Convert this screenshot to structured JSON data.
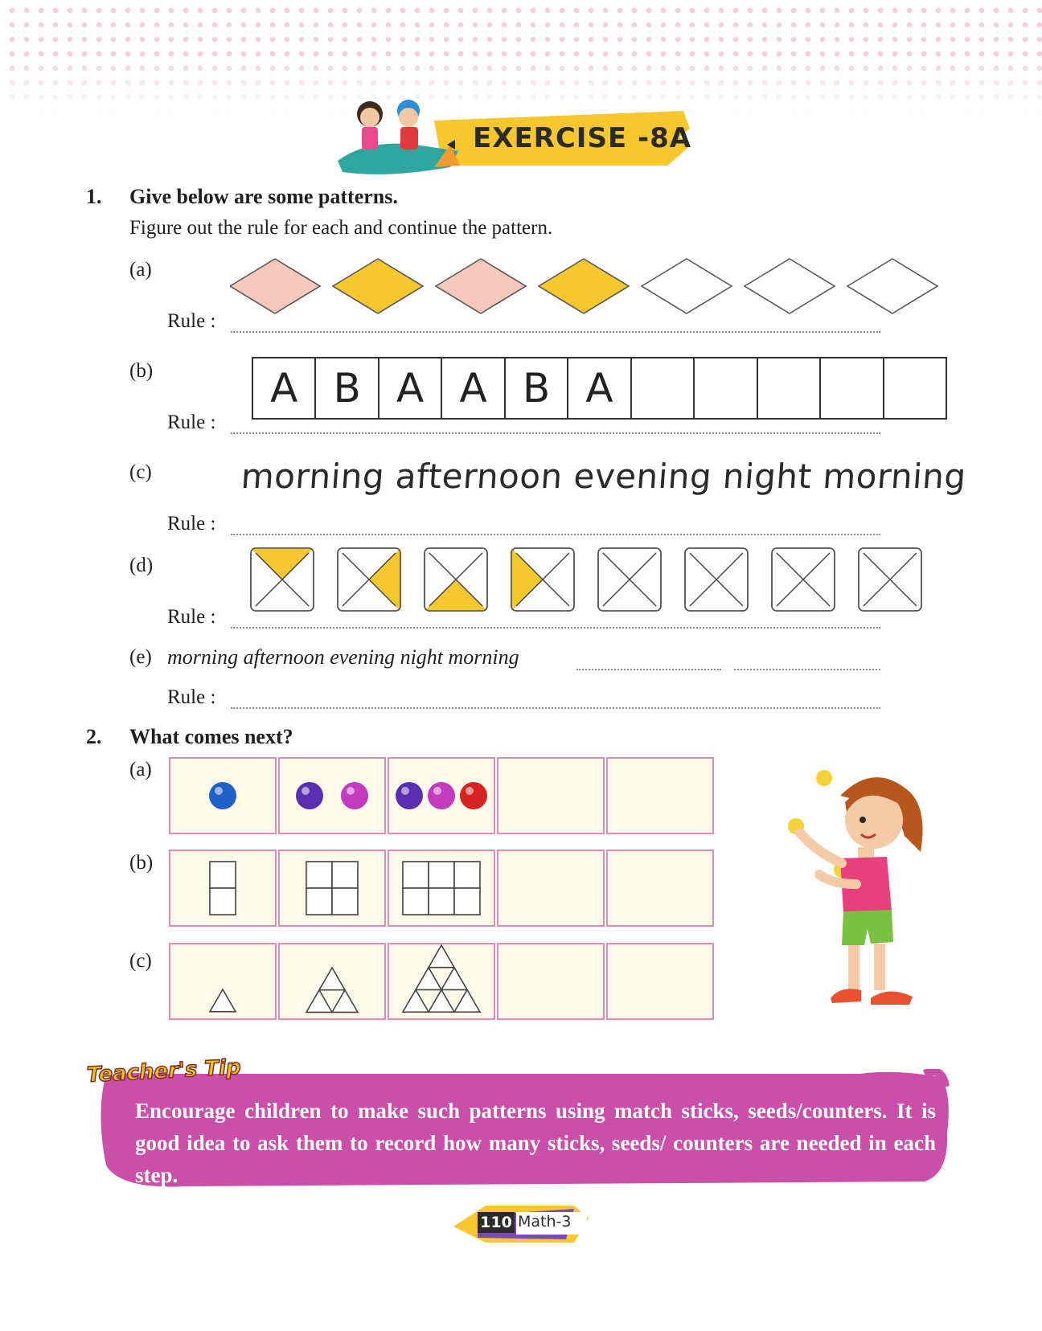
{
  "exercise": {
    "title": "EXERCISE -8A"
  },
  "q1": {
    "number": "1.",
    "heading": "Give below are some patterns.",
    "subheading": "Figure out the rule for each and continue the pattern.",
    "rule_label": "Rule :",
    "a": {
      "label": "(a)",
      "diamond_fills": [
        "#f7c9bd",
        "#f6c72f",
        "#f7c9bd",
        "#f6c72f",
        "#ffffff",
        "#ffffff",
        "#ffffff"
      ]
    },
    "b": {
      "label": "(b)",
      "cells": [
        "A",
        "B",
        "A",
        "A",
        "B",
        "A",
        "",
        "",
        "",
        "",
        ""
      ]
    },
    "c": {
      "label": "(c)",
      "sequence": "morning afternoon evening night morning"
    },
    "d": {
      "label": "(d)",
      "shaded_quadrant": [
        "top",
        "right",
        "bottom",
        "left",
        "none",
        "none",
        "none",
        "none"
      ],
      "shade_color": "#f6c72f"
    },
    "e": {
      "label": "(e)",
      "sequence": "morning afternoon evening night morning"
    }
  },
  "q2": {
    "number": "2.",
    "heading": "What comes next?",
    "a": {
      "label": "(a)",
      "ball_colors": [
        [
          "#1e5fc9"
        ],
        [
          "#5a2fb0",
          "#c23bbd"
        ],
        [
          "#5a2fb0",
          "#c23bbd",
          "#d7231f"
        ],
        [],
        []
      ]
    },
    "b": {
      "label": "(b)",
      "grid_columns": [
        1,
        2,
        3,
        0,
        0
      ]
    },
    "c": {
      "label": "(c)",
      "triangle_rows": [
        1,
        2,
        3,
        0,
        0
      ]
    }
  },
  "tip": {
    "label": "Teacher's Tip",
    "text": "Encourage children to make such patterns using match sticks, seeds/counters. It is good idea to ask them to record how many sticks, seeds/ counters are needed in each step."
  },
  "footer": {
    "page_number": "110",
    "book": "Math-3"
  },
  "colors": {
    "tip_background": "#c94fa8",
    "box_border": "#e58ab8",
    "box_fill": "#fffbea"
  }
}
